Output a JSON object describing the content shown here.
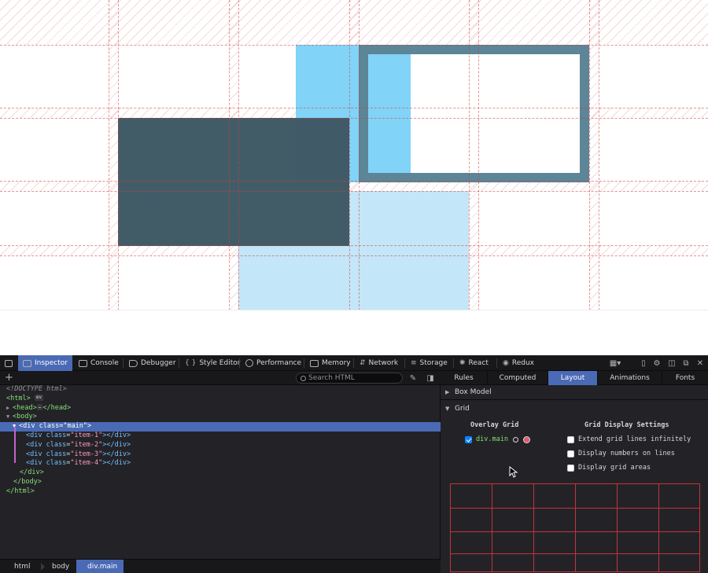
{
  "page": {
    "item_colors": {
      "light_blue": "#81d3f7",
      "pale_blue": "#c3e6f8",
      "dark_slate": "#3e5964",
      "frame": "#5c8597"
    },
    "grid_line_color": "#d73c3c"
  },
  "toolbar": {
    "pick_icon": "element-picker-icon",
    "tabs": [
      {
        "label": "Inspector",
        "icon": "inspector-icon",
        "active": true
      },
      {
        "label": "Console",
        "icon": "console-icon"
      },
      {
        "label": "Debugger",
        "icon": "debugger-icon"
      },
      {
        "label": "Style Editor",
        "icon": "braces-icon"
      },
      {
        "label": "Performance",
        "icon": "gauge-icon"
      },
      {
        "label": "Memory",
        "icon": "memory-icon"
      },
      {
        "label": "Network",
        "icon": "network-icon"
      },
      {
        "label": "Storage",
        "icon": "storage-icon"
      },
      {
        "label": "React",
        "icon": "react-icon"
      },
      {
        "label": "Redux",
        "icon": "redux-icon"
      }
    ],
    "right_icons": [
      "responsive-icon",
      "device-icon",
      "settings-icon",
      "dock-icon",
      "undock-icon",
      "close-icon"
    ]
  },
  "markup_panel": {
    "search_placeholder": "Search HTML",
    "lines": {
      "doctype": "<!DOCTYPE html>",
      "html_open": "<html>",
      "ev_badge": "ev",
      "head_open": "<head>",
      "head_ellipsis": "…",
      "head_close": "</head>",
      "body_open": "<body>",
      "div_tag": "div",
      "class_attr": "class",
      "main_val": "\"main\"",
      "items": [
        "\"item-1\"",
        "\"item-2\"",
        "\"item-3\"",
        "\"item-4\""
      ],
      "div_close": "</div>",
      "body_close": "</body>",
      "html_close": "</html>"
    },
    "breadcrumbs": [
      "html",
      "body",
      "div.main"
    ]
  },
  "sidebar": {
    "tabs": [
      "Rules",
      "Computed",
      "Layout",
      "Animations",
      "Fonts"
    ],
    "active_tab": "Layout",
    "sections": {
      "box_model": "Box Model",
      "grid": "Grid"
    },
    "overlay_grid": {
      "title": "Overlay Grid",
      "grid_name": "div.main",
      "checked": true,
      "swatch_color": "#e0596a"
    },
    "display_settings": {
      "title": "Grid Display Settings",
      "options": [
        {
          "label": "Extend grid lines infinitely",
          "checked": false
        },
        {
          "label": "Display numbers on lines",
          "checked": false
        },
        {
          "label": "Display grid areas",
          "checked": false
        }
      ]
    }
  }
}
